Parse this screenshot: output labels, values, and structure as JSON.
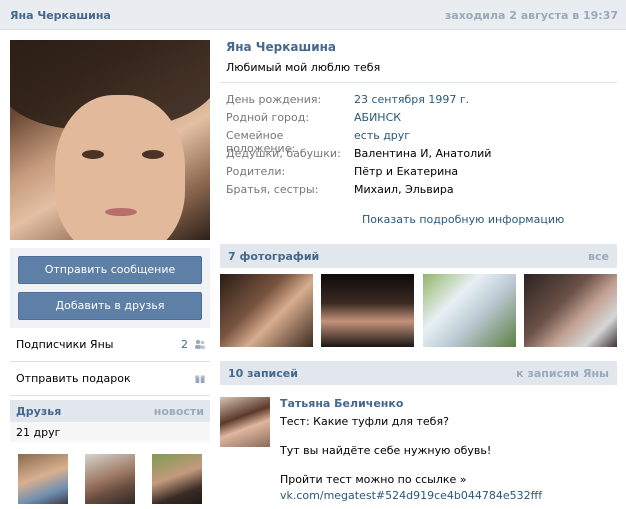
{
  "header": {
    "name": "Яна Черкашина",
    "last_seen": "заходила 2 августа в 19:37"
  },
  "actions": {
    "send_message": "Отправить сообщение",
    "add_friend": "Добавить в друзья"
  },
  "left_links": {
    "subscribers_label": "Подписчики Яны",
    "subscribers_count": "2",
    "gift_label": "Отправить подарок"
  },
  "friends": {
    "title": "Друзья",
    "news": "новости",
    "count": "21 друг"
  },
  "profile": {
    "name": "Яна Черкашина",
    "status": "Любимый мой люблю тебя",
    "info": [
      {
        "key": "День рождения:",
        "value": "23 сентября 1997 г.",
        "link": true
      },
      {
        "key": "Родной город:",
        "value": "АБИНСК",
        "link": true
      },
      {
        "key": "Семейное положение:",
        "value": "есть друг",
        "link": true
      },
      {
        "key": "Дедушки, бабушки:",
        "value": "Валентина И, Анатолий",
        "link": false
      },
      {
        "key": "Родители:",
        "value": "Пётр и Екатерина",
        "link": false
      },
      {
        "key": "Братья, сестры:",
        "value": "Михаил, Эльвира",
        "link": false
      }
    ],
    "more_link": "Показать подробную информацию"
  },
  "photos": {
    "title": "7 фотографий",
    "all": "все"
  },
  "posts": {
    "title": "10 записей",
    "to_posts": "к записям Яны",
    "first": {
      "author": "Татьяна Беличенко",
      "line1": "Тест: Какие туфли для тебя?",
      "line2": "Тут вы найдёте себе нужную обувь!",
      "line3": "Пройти тест можно по ссылке »",
      "url": "vk.com/megatest#524d919ce4b044784e532fff"
    }
  },
  "colors": {
    "link": "#45688e",
    "button": "#5e80a7",
    "header_bg": "#e9edf1"
  }
}
